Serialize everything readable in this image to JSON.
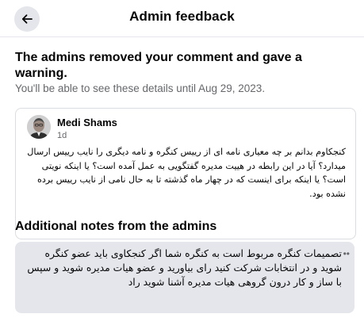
{
  "header": {
    "title": "Admin feedback",
    "back_icon": "arrow-left-icon"
  },
  "warning": {
    "title": "The admins removed your comment and gave a warning.",
    "subtitle": "You'll be able to see these details until Aug 29, 2023."
  },
  "comment": {
    "author": "Medi Shams",
    "time": "1d",
    "text": "کنجکاوم بدانم بر چه معیاری نامه ای از رییس کنگره و نامه دیگری را نایب رییس ارسال میدارد؟ آیا در این رابطه در هییت مدیره گفتگویی به عمل آمده است؟ یا اینکه نویتی است؟ یا اینکه برای اینست که در چهار ماه گذشته تا به حال نامی از نایب رییس برده نشده بود."
  },
  "notes": {
    "title": "Additional notes from the admins",
    "text": "تصمیمات کنگره مربوط است به کنگره شما اگر کنجکاوی باید عضو کنگره شوید و در انتخابات شرکت کنید رای بیاورید و عضو هیات مدیره شوید و سپس با ساز و کار درون گروهی هیات مدیره آشنا شوید راد",
    "menu_icon": "more-dots-icon"
  },
  "colors": {
    "background": "#ffffff",
    "secondary_text": "#65676b",
    "notes_bg": "#e4e6eb",
    "border": "#dadde1"
  }
}
